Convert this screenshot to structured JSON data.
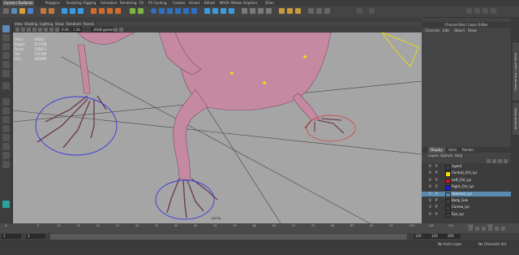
{
  "menubar": {
    "menu_set": "Curves / Surfaces",
    "tabs": [
      "Curves / Surfaces",
      "Polygons",
      "Sculpting",
      "Rigging",
      "Animation",
      "Rendering",
      "FX",
      "FX Caching",
      "Custom",
      "Arnold",
      "Bifrost",
      "MASH",
      "Motion Graphics",
      "XGen"
    ]
  },
  "shelf_tabs": [],
  "panel_menu": [
    "View",
    "Shading",
    "Lighting",
    "Show",
    "Renderer",
    "Panels"
  ],
  "panel_toolbar": {
    "camera_value": "0.00",
    "gamma_value": "1.00",
    "color_space": "sRGB gamma"
  },
  "hud": {
    "rows": [
      {
        "label": "Verts:",
        "value": "44543"
      },
      {
        "label": "Edges:",
        "value": "117768"
      },
      {
        "label": "Faces:",
        "value": "136613"
      },
      {
        "label": "Tris:",
        "value": "151789"
      },
      {
        "label": "UVs:",
        "value": "162095"
      }
    ],
    "camera_label": "persp"
  },
  "channel_box": {
    "title": "Channel Box / Layer Editor",
    "menu": [
      "Channels",
      "Edit",
      "Object",
      "Show"
    ]
  },
  "side_tabs": [
    "Channel Box / Layer Editor",
    "Attribute Editor"
  ],
  "layer_editor": {
    "tabs": [
      "Display",
      "Anim",
      "Render"
    ],
    "active_tab": "Display",
    "menu": [
      "Layers",
      "Options",
      "Help"
    ],
    "layers": [
      {
        "v": "V",
        "p": "P",
        "color": "",
        "name": "layer2",
        "selected": false
      },
      {
        "v": "V",
        "p": "P",
        "color": "#f3e600",
        "name": "Central_Ctrl_Lyr",
        "selected": false
      },
      {
        "v": "V",
        "p": "P",
        "color": "#e01010",
        "name": "Left_Ctrl_Lyr",
        "selected": false
      },
      {
        "v": "V",
        "p": "P",
        "color": "#1a1ae0",
        "name": "Right_Ctrl_Lyr",
        "selected": false
      },
      {
        "v": "V",
        "p": "R",
        "color": "",
        "name": "Skeleton_Lyr",
        "selected": true
      },
      {
        "v": "V",
        "p": "P",
        "color": "",
        "name": "Body_Geo",
        "selected": false
      },
      {
        "v": "V",
        "p": "P",
        "color": "",
        "name": "Cornea_Lyr",
        "selected": false
      },
      {
        "v": "V",
        "p": "P",
        "color": "",
        "name": "Eye_Lyr",
        "selected": false
      }
    ]
  },
  "timeline": {
    "ticks": [
      "5",
      "10",
      "15",
      "20",
      "25",
      "30",
      "35",
      "40",
      "45",
      "50",
      "55",
      "60",
      "65",
      "70",
      "75",
      "80",
      "85",
      "90",
      "95",
      "100",
      "105",
      "110",
      "115",
      "120"
    ],
    "current_frame": "1"
  },
  "range_slider": {
    "start_value": "1",
    "inner_start": "1",
    "inner_end": "120",
    "end_value": "120",
    "end_value2": "200",
    "anim_layer": "No Anim Layer",
    "char_set": "No Character Set"
  },
  "colors": {
    "accent": "#5c8bb0",
    "viewport": "#a5a5a5",
    "mesh": "#c58aa2"
  }
}
